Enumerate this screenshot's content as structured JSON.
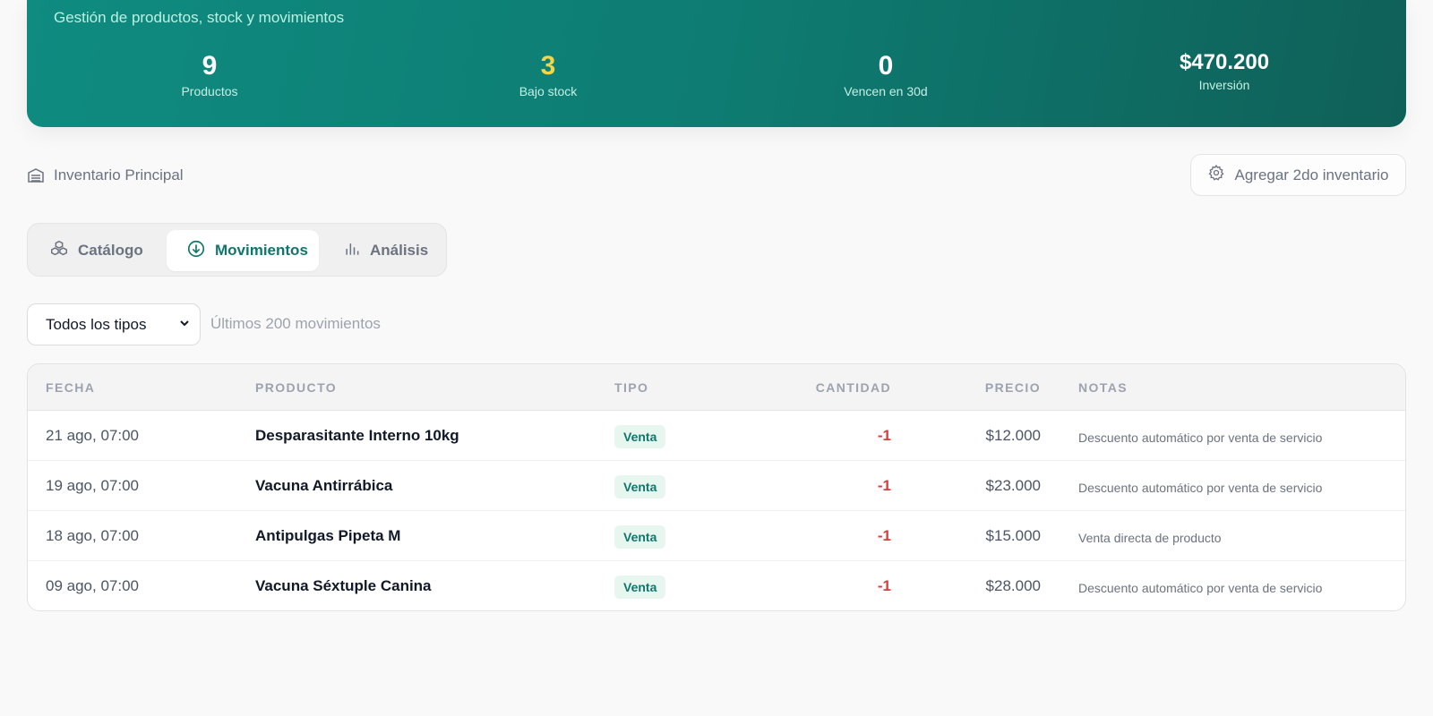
{
  "header": {
    "subtitle": "Gestión de productos, stock y movimientos",
    "stats": [
      {
        "value": "9",
        "label": "Productos"
      },
      {
        "value": "3",
        "label": "Bajo stock"
      },
      {
        "value": "0",
        "label": "Vencen en 30d"
      },
      {
        "value": "$470.200",
        "label": "Inversión"
      }
    ],
    "colors": {
      "gradient_start": "#0f8b80",
      "gradient_end": "#0f6058",
      "warn": "#f5d547"
    }
  },
  "inventory": {
    "label": "Inventario Principal",
    "add_button": "Agregar 2do inventario"
  },
  "tabs": [
    {
      "label": "Catálogo",
      "icon": "cubes-icon",
      "active": false
    },
    {
      "label": "Movimientos",
      "icon": "arrow-down-circle-icon",
      "active": true
    },
    {
      "label": "Análisis",
      "icon": "bar-chart-icon",
      "active": false
    }
  ],
  "filter": {
    "selected": "Todos los tipos",
    "note": "Últimos 200 movimientos"
  },
  "table": {
    "columns": [
      "FECHA",
      "PRODUCTO",
      "TIPO",
      "CANTIDAD",
      "PRECIO",
      "NOTAS"
    ],
    "rows": [
      {
        "fecha": "21 ago, 07:00",
        "producto": "Desparasitante Interno 10kg",
        "tipo": "Venta",
        "cantidad": "-1",
        "precio": "$12.000",
        "notas": "Descuento automático por venta de servicio"
      },
      {
        "fecha": "19 ago, 07:00",
        "producto": "Vacuna Antirrábica",
        "tipo": "Venta",
        "cantidad": "-1",
        "precio": "$23.000",
        "notas": "Descuento automático por venta de servicio"
      },
      {
        "fecha": "18 ago, 07:00",
        "producto": "Antipulgas Pipeta M",
        "tipo": "Venta",
        "cantidad": "-1",
        "precio": "$15.000",
        "notas": "Venta directa de producto"
      },
      {
        "fecha": "09 ago, 07:00",
        "producto": "Vacuna Séxtuple Canina",
        "tipo": "Venta",
        "cantidad": "-1",
        "precio": "$28.000",
        "notas": "Descuento automático por venta de servicio"
      }
    ]
  }
}
